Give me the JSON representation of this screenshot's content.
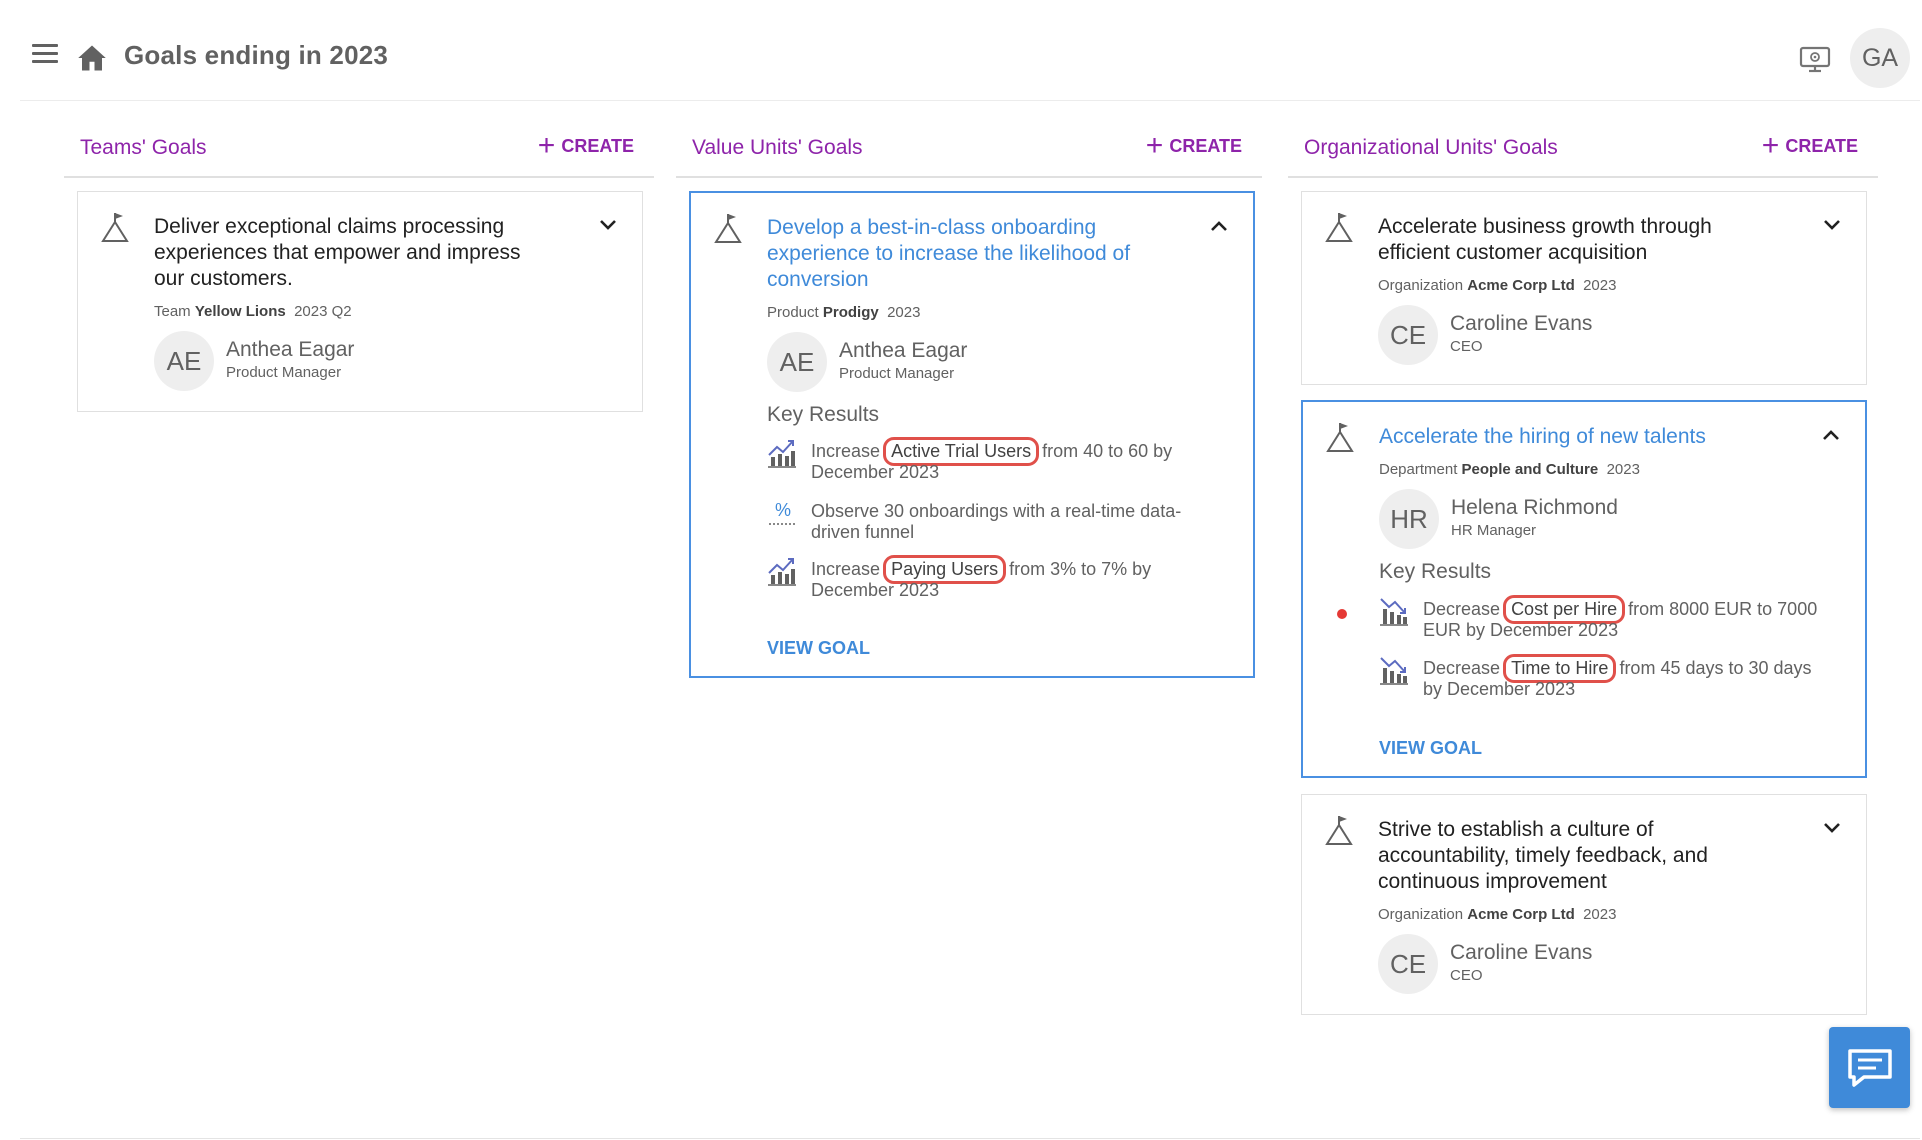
{
  "header": {
    "title": "Goals ending in 2023",
    "user_initials": "GA",
    "icons": [
      "menu-icon",
      "home-icon",
      "presentation-icon"
    ]
  },
  "columns": [
    {
      "title": "Teams' Goals",
      "create_label": "CREATE",
      "goals": [
        {
          "title": "Deliver exceptional claims processing experiences that empower and impress our customers.",
          "unit_type": "Team",
          "unit_name": "Yellow Lions",
          "period": "2023 Q2",
          "owner_initials": "AE",
          "owner_name": "Anthea Eagar",
          "owner_role": "Product Manager",
          "expanded": false
        }
      ]
    },
    {
      "title": "Value Units' Goals",
      "create_label": "CREATE",
      "goals": [
        {
          "title": "Develop a best-in-class onboarding experience to increase the likelihood of conversion",
          "unit_type": "Product",
          "unit_name": "Prodigy",
          "period": "2023",
          "owner_initials": "AE",
          "owner_name": "Anthea Eagar",
          "owner_role": "Product Manager",
          "expanded": true,
          "key_results_heading": "Key Results",
          "key_results": [
            {
              "icon": "chart-increase-icon",
              "pre": "Increase",
              "metric": "Active Trial Users",
              "post": "from 40 to 60 by December 2023",
              "highlighted": true
            },
            {
              "icon": "percent-icon",
              "pre": "Observe 30 onboardings with a real-time data-driven funnel",
              "metric": "",
              "post": "",
              "highlighted": false
            },
            {
              "icon": "chart-increase-icon",
              "pre": "Increase",
              "metric": "Paying Users",
              "post": "from 3% to 7% by December 2023",
              "highlighted": true
            }
          ],
          "view_goal_label": "VIEW GOAL"
        }
      ]
    },
    {
      "title": "Organizational Units' Goals",
      "create_label": "CREATE",
      "goals": [
        {
          "title": "Accelerate business growth through efficient customer acquisition",
          "unit_type": "Organization",
          "unit_name": "Acme Corp Ltd",
          "period": "2023",
          "owner_initials": "CE",
          "owner_name": "Caroline Evans",
          "owner_role": "CEO",
          "expanded": false
        },
        {
          "title": "Accelerate the hiring of new talents",
          "unit_type": "Department",
          "unit_name": "People and Culture",
          "period": "2023",
          "owner_initials": "HR",
          "owner_name": "Helena Richmond",
          "owner_role": "HR Manager",
          "expanded": true,
          "key_results_heading": "Key Results",
          "key_results": [
            {
              "icon": "chart-decrease-icon",
              "pre": "Decrease",
              "metric": "Cost per Hire",
              "post": "from 8000 EUR to 7000 EUR by December 2023",
              "highlighted": true,
              "status": "red"
            },
            {
              "icon": "chart-decrease-icon",
              "pre": "Decrease",
              "metric": "Time to Hire",
              "post": "from 45 days to 30 days by December 2023",
              "highlighted": true
            }
          ],
          "view_goal_label": "VIEW GOAL"
        },
        {
          "title": "Strive to establish a culture of accountability, timely feedback, and continuous improvement",
          "unit_type": "Organization",
          "unit_name": "Acme Corp Ltd",
          "period": "2023",
          "owner_initials": "CE",
          "owner_name": "Caroline Evans",
          "owner_role": "CEO",
          "expanded": false
        }
      ]
    }
  ],
  "colors": {
    "accent": "#8e24aa",
    "link": "#3f8ad9",
    "highlight": "#e0504a",
    "status_red": "#e53935"
  },
  "chat_button_icon": "chat-icon"
}
